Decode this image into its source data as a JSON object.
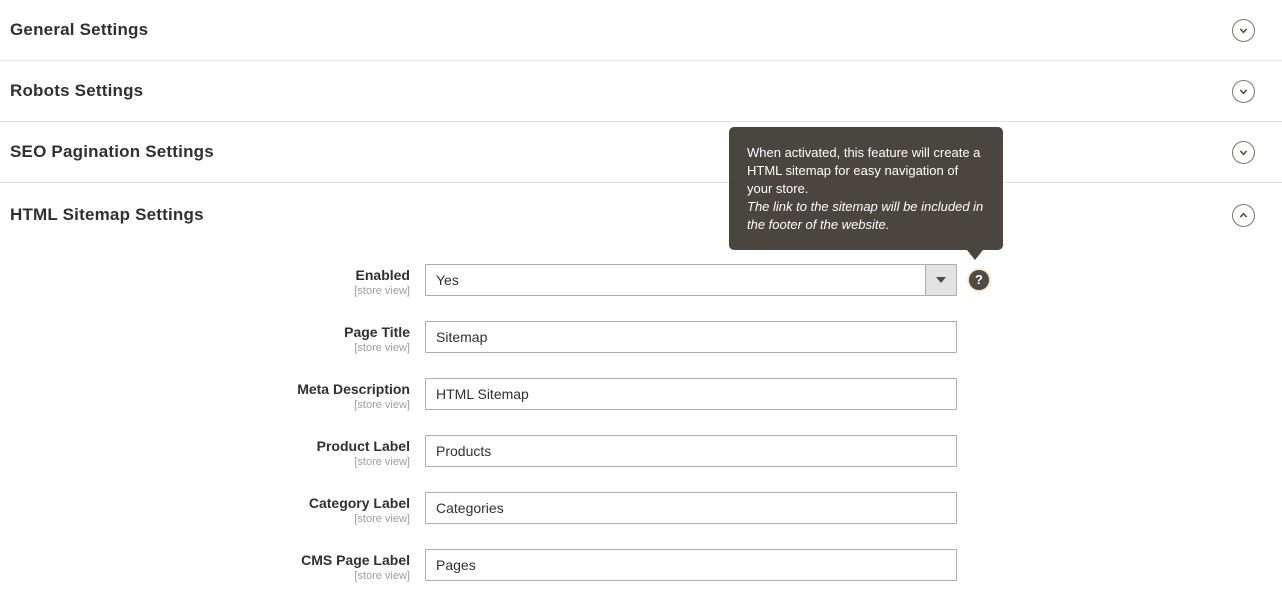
{
  "sections": [
    {
      "title": "General Settings",
      "expanded": false
    },
    {
      "title": "Robots Settings",
      "expanded": false
    },
    {
      "title": "SEO Pagination Settings",
      "expanded": false
    },
    {
      "title": "HTML Sitemap Settings",
      "expanded": true
    }
  ],
  "form": {
    "fields": [
      {
        "label": "Enabled",
        "scope": "[store view]",
        "type": "select",
        "value": "Yes"
      },
      {
        "label": "Page Title",
        "scope": "[store view]",
        "type": "text",
        "value": "Sitemap"
      },
      {
        "label": "Meta Description",
        "scope": "[store view]",
        "type": "text",
        "value": "HTML Sitemap"
      },
      {
        "label": "Product Label",
        "scope": "[store view]",
        "type": "text",
        "value": "Products"
      },
      {
        "label": "Category Label",
        "scope": "[store view]",
        "type": "text",
        "value": "Categories"
      },
      {
        "label": "CMS Page Label",
        "scope": "[store view]",
        "type": "text",
        "value": "Pages"
      }
    ]
  },
  "tooltip": {
    "text": "When activated, this feature will create a HTML sitemap for easy navigation of your store.",
    "note": "The link to the sitemap will be included in the footer of the website."
  },
  "icons": {
    "help_glyph": "?"
  },
  "colors": {
    "tooltip_background": "#4a453f",
    "heading_text": "#303030",
    "scope_text": "#9e9e9e",
    "input_border": "#adadad",
    "divider": "#e3e3e3",
    "help_icon_background": "#514943",
    "caret_button_background": "#e3e3e3"
  }
}
